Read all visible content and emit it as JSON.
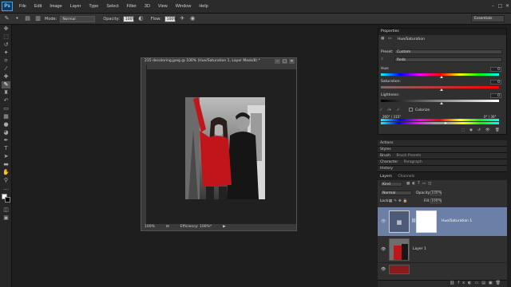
{
  "menu": {
    "logo": "Ps",
    "items": [
      "File",
      "Edit",
      "Image",
      "Layer",
      "Type",
      "Select",
      "Filter",
      "3D",
      "View",
      "Window",
      "Help"
    ]
  },
  "options": {
    "mode_label": "Mode:",
    "mode_value": "Normal",
    "opacity_label": "Opacity:",
    "opacity_value": "100%",
    "flow_label": "Flow:",
    "flow_value": "100%",
    "workspace": "Essentials"
  },
  "document": {
    "title": "215 decoloring.jpeg @ 100% (Hue/Saturation 1, Layer Mask/8) *",
    "zoom": "100%",
    "status": "Efficiency: 100%*"
  },
  "properties": {
    "tab": "Properties",
    "adjustment": "Hue/Saturation",
    "preset_label": "Preset:",
    "preset_value": "Custom",
    "channel_value": "Reds",
    "hue_label": "Hue:",
    "hue_value": "0",
    "saturation_label": "Saturation:",
    "saturation_value": "0",
    "lightness_label": "Lightness:",
    "lightness_value": "0",
    "colorize_label": "Colorize",
    "range_left": "260° / 315°",
    "range_right": "0° \\ 30°"
  },
  "panels": {
    "actions": "Actions",
    "styles": "Styles",
    "brush": "Brush",
    "brush_presets": "Brush Presets",
    "character": "Character",
    "paragraph": "Paragraph",
    "history": "History",
    "layers": "Layers",
    "channels": "Channels"
  },
  "layers": {
    "kind": "Kind",
    "blend_mode": "Normal",
    "opacity_label": "Opacity:",
    "opacity_value": "100%",
    "lock_label": "Lock:",
    "fill_label": "Fill:",
    "fill_value": "100%",
    "items": [
      {
        "name": "Hue/Saturation 1",
        "selected": true
      },
      {
        "name": "Layer 1",
        "selected": false
      },
      {
        "name": "",
        "selected": false
      }
    ]
  },
  "colors": {
    "accent_selected": "#6c7fa6",
    "jacket": "#c0151a"
  }
}
